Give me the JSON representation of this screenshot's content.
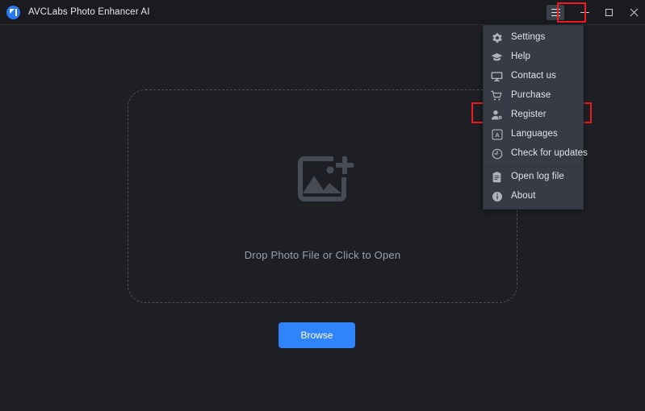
{
  "window": {
    "title": "AVCLabs Photo Enhancer AI",
    "logo_icon": "avclabs-logo-icon",
    "controls": {
      "menu_icon": "hamburger-menu-icon",
      "minimize_icon": "minimize-icon",
      "maximize_icon": "maximize-icon",
      "close_icon": "close-icon"
    }
  },
  "main": {
    "dropzone": {
      "icon": "image-add-icon",
      "label": "Drop Photo File or Click to Open"
    },
    "browse_button": {
      "label": "Browse"
    }
  },
  "menu": {
    "items": [
      {
        "label": "Settings",
        "icon": "gear-icon",
        "separator_above": false
      },
      {
        "label": "Help",
        "icon": "graduation-cap-icon",
        "separator_above": false
      },
      {
        "label": "Contact us",
        "icon": "monitor-icon",
        "separator_above": false
      },
      {
        "label": "Purchase",
        "icon": "shopping-cart-icon",
        "separator_above": false
      },
      {
        "label": "Register",
        "icon": "user-register-icon",
        "separator_above": false
      },
      {
        "label": "Languages",
        "icon": "language-a-icon",
        "separator_above": false
      },
      {
        "label": "Check for updates",
        "icon": "refresh-icon",
        "separator_above": false
      },
      {
        "label": "Open log file",
        "icon": "clipboard-icon",
        "separator_above": true
      },
      {
        "label": "About",
        "icon": "info-icon",
        "separator_above": false
      }
    ]
  },
  "highlights": [
    {
      "name": "menu-button-highlight",
      "color": "#ee1c20"
    },
    {
      "name": "register-item-highlight",
      "color": "#ee1c20"
    }
  ],
  "colors": {
    "window_bg": "#1d1f24",
    "titlebar_bg": "#191b1f",
    "menu_bg": "#373b45",
    "accent_blue": "#2f83fb",
    "logo_blue": "#2979f2",
    "highlight_red": "#ee1c20",
    "muted_text": "#9ba0ab"
  }
}
